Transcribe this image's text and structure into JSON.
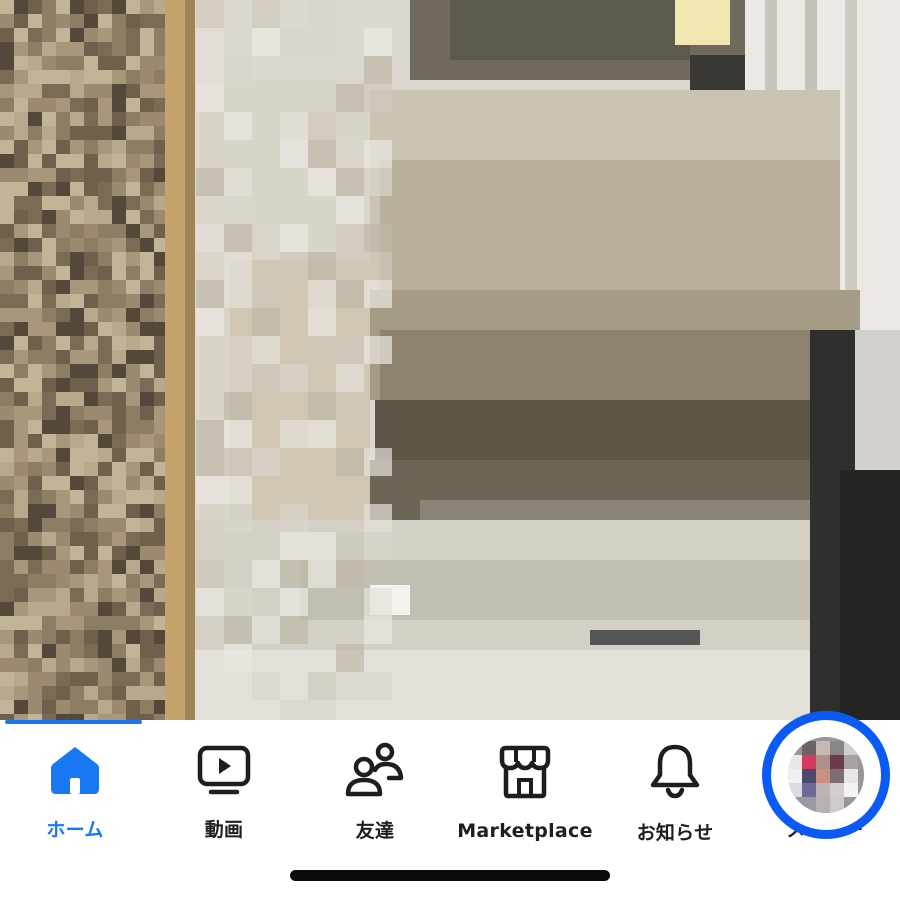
{
  "tabs": [
    {
      "id": "home",
      "label": "ホーム",
      "icon": "home-icon",
      "active": true
    },
    {
      "id": "video",
      "label": "動画",
      "icon": "video-icon",
      "active": false
    },
    {
      "id": "friends",
      "label": "友達",
      "icon": "friends-icon",
      "active": false
    },
    {
      "id": "marketplace",
      "label": "Marketplace",
      "icon": "marketplace-icon",
      "active": false
    },
    {
      "id": "notifications",
      "label": "お知らせ",
      "icon": "bell-icon",
      "active": false
    },
    {
      "id": "menu",
      "label": "メニュー",
      "icon": "avatar",
      "active": false,
      "highlighted": true
    }
  ],
  "colors": {
    "accent": "#1877f2",
    "highlight_ring": "#0a5bf5",
    "text": "#1c1e21"
  },
  "photo": {
    "style": "pixelated"
  }
}
